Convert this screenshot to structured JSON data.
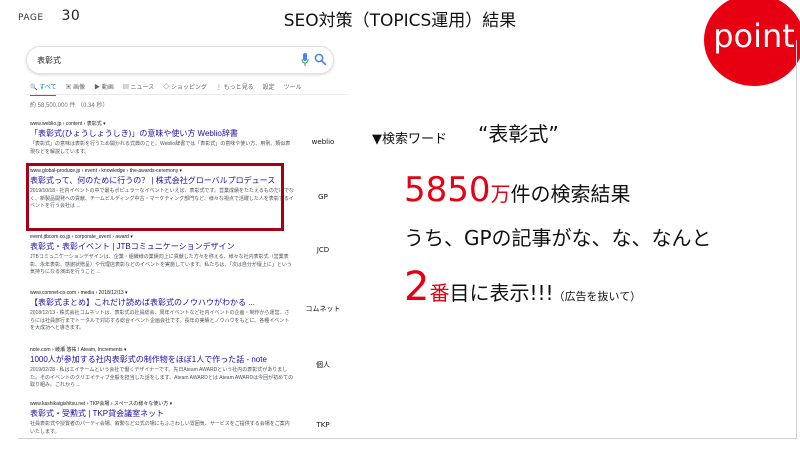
{
  "page": {
    "label": "PAGE",
    "number": "30"
  },
  "title": "SEO対策（TOPICS運用）結果",
  "badge": "point",
  "serp": {
    "query": "表彰式",
    "tabs": [
      "すべて",
      "画像",
      "動画",
      "ニュース",
      "ショッピング",
      "もっと見る",
      "設定",
      "ツール"
    ],
    "stats": "約 58,500,000 件 （0.34 秒）",
    "results": [
      {
        "url": "www.weblio.jp › content › 表彰式 ▾",
        "title": "「表彰式(ひょうしょうしき)」の意味や使い方 Weblio辞書",
        "snippet": "「表彰式」の意味は表彰を行うため開かれる式典のこと。Weblio辞書では「表彰式」の意味や使い方、用例、類似表現などを解説しています。"
      },
      {
        "url": "www.global-produce.jp › event › knowledge › the-awards-ceremony ▾",
        "title": "表彰式って、何のために行うの？ | 株式会社グローバルプロデュース",
        "snippet": "2019/10/18 - 社内イベントの中で最もポピュラーなイベントといえば、表彰式です。営業成績をたたえるものだけでなく、新製品開発への貢献、チームビルディング中古・マーケティング部門など、様々な視点で活躍した人を表彰するイベントを行う会社は ..."
      },
      {
        "url": "event.jtbcom.co.jp › corporate_event › award ▾",
        "title": "表彰式・表彰イベント | JTBコミュニケーションデザイン",
        "snippet": "JTBコミュニケーションデザインは、企業・組織様の業績向上に貢献した方々を称える、様々な社内表彰式（営業表彰、永年表彰、感謝状贈呈）や代理店表彰などのイベントを実施しています。私たちは、「次は自分が壇上に」という気持ちになる演出を行うこと ..."
      },
      {
        "url": "www.comnet-co.com › media › 2018/12/13 ▾",
        "title": "【表彰式まとめ】これだけ読めば表彰式のノウハウがわかる ...",
        "snippet": "2018/12/13 - 株式会社コムネットは、表彰式の社員総会、周年イベントなど社内イベントの企画・制作から運営、さらには社員旅行までトータルで対応する総合イベント企画会社です。長年の実績とノウハウをもとに、各種イベントを大成功へと導きます。"
      },
      {
        "url": "note.com › 綾瀬 悠祐 / Ateam, Increments ▾",
        "title": "1000人が参加する社内表彰式の制作物をほぼ1人で作った話 - note",
        "snippet": "2019/02/28 - 私はエイチームという会社で働くデザイナーです。先日Ateam AWARDという社内の表彰式がありました。そのイベントのクリエイティブ全般を担当した話をします。Ateam AWARDとは Ateam AWARDは今回が初めての取り組み。これから ..."
      },
      {
        "url": "www.kashikaigishitsu.net › TKP会場 › スペースの様々な使い方 ▾",
        "title": "表彰式・受勲式 | TKP貸会議室ネット",
        "snippet": "社員表彰式や授賞者のパーティ会場、叙勲など公式の場にもふさわしい雰囲気、サービスをご提供する会場をご案内いたします。"
      }
    ]
  },
  "labels": [
    "weblio",
    "GP",
    "JCD",
    "コムネット",
    "個人",
    "TKP"
  ],
  "keyword": {
    "label": "▼検索ワード",
    "value": "“表彰式”"
  },
  "summary": {
    "count_num": "5850",
    "count_unit": "万",
    "count_rest": "件の検索結果",
    "line2": "うち、GPの記事がな、な、なんと",
    "rank_num": "2",
    "rank_unit": "番",
    "rank_rest": "目に表示!!!",
    "note": "（広告を抜いて）"
  },
  "colors": {
    "accent_red": "#e60012",
    "highlight_border": "#a50018",
    "link_blue": "#1a0dab"
  }
}
